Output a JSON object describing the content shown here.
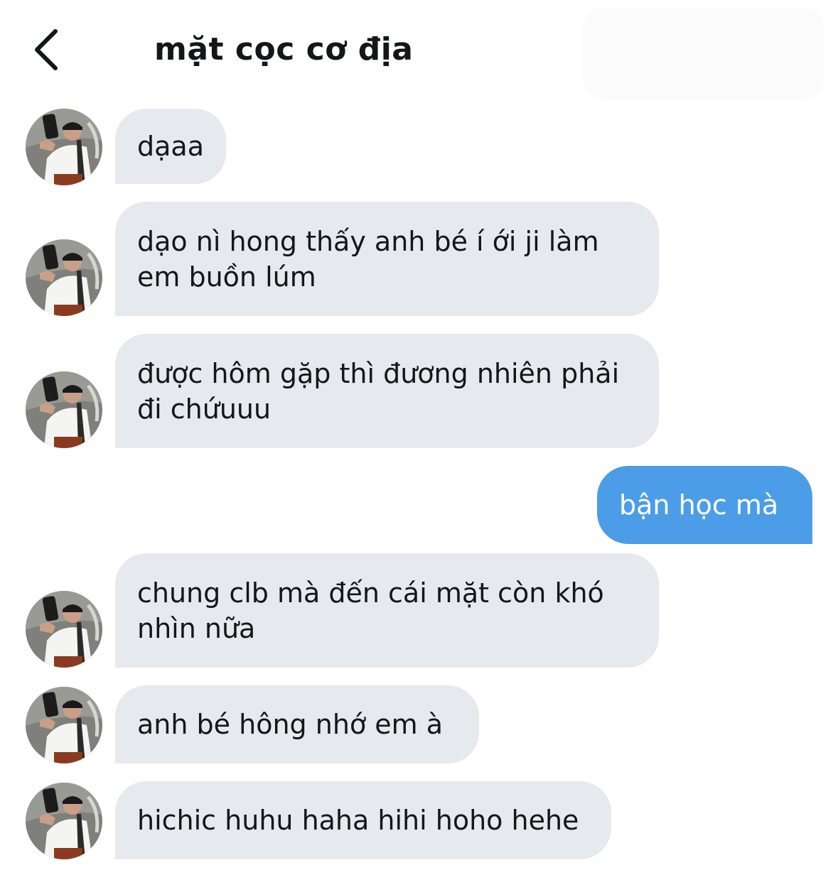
{
  "header": {
    "title": "mặt cọc cơ địa",
    "back_icon": "chevron-left-icon"
  },
  "colors": {
    "incoming_bubble": "#e6e9ed",
    "outgoing_bubble": "#4c9de8",
    "text": "#14171a"
  },
  "messages": [
    {
      "direction": "incoming",
      "lines": [
        "dạaa"
      ]
    },
    {
      "direction": "incoming",
      "lines": [
        "dạo nì hong thấy anh bé í ới ji làm",
        "em buồn lúm"
      ]
    },
    {
      "direction": "incoming",
      "lines": [
        "được hôm gặp thì đương nhiên phải",
        "đi chứuuu"
      ]
    },
    {
      "direction": "outgoing",
      "lines": [
        "bận học mà"
      ]
    },
    {
      "direction": "incoming",
      "lines": [
        "chung clb mà đến cái mặt còn khó",
        "nhìn nữa"
      ]
    },
    {
      "direction": "incoming",
      "lines": [
        "anh bé hông nhớ em à"
      ]
    },
    {
      "direction": "incoming",
      "lines": [
        "hichic huhu haha hihi hoho hehe"
      ]
    }
  ]
}
